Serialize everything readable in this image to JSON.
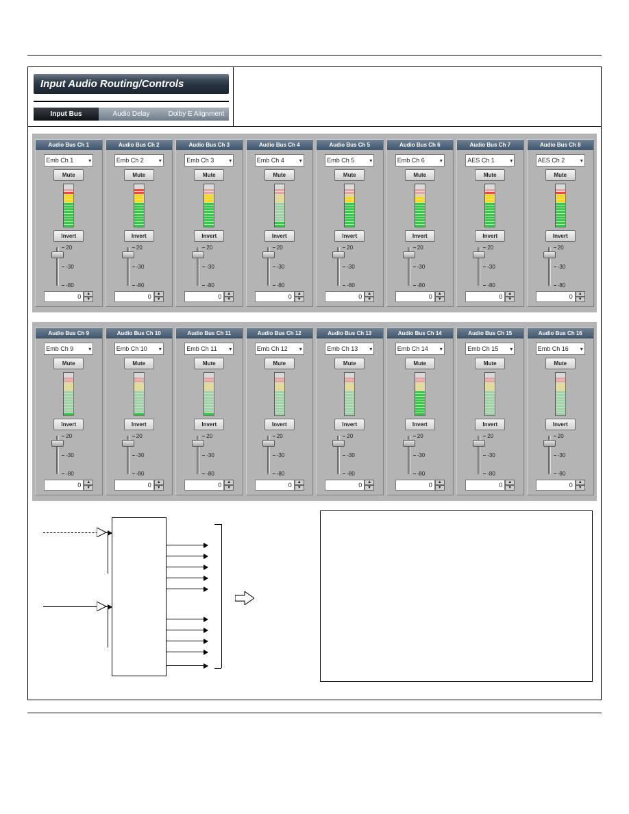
{
  "header": {
    "title": "Input Audio Routing/Controls",
    "tabs": [
      "Input Bus",
      "Audio Delay",
      "Dolby E Alignment"
    ],
    "active_tab": 0
  },
  "ui": {
    "mute_label": "Mute",
    "invert_label": "Invert",
    "slider_ticks": [
      "20",
      "-30",
      "-80"
    ],
    "dropdown_caret": "▾"
  },
  "channels_top": [
    {
      "header": "Audio Bus Ch 1",
      "source": "Emb Ch 1",
      "gain": 0,
      "meter_on": 13
    },
    {
      "header": "Audio Bus Ch 2",
      "source": "Emb Ch 2",
      "gain": 0,
      "meter_on": 14
    },
    {
      "header": "Audio Bus Ch 3",
      "source": "Emb Ch 3",
      "gain": 0,
      "meter_on": 12
    },
    {
      "header": "Audio Bus Ch 4",
      "source": "Emb Ch 4",
      "gain": 0,
      "meter_on": 2
    },
    {
      "header": "Audio Bus Ch 5",
      "source": "Emb Ch 5",
      "gain": 0,
      "meter_on": 11
    },
    {
      "header": "Audio Bus Ch 6",
      "source": "Emb Ch 6",
      "gain": 0,
      "meter_on": 11
    },
    {
      "header": "Audio Bus Ch 7",
      "source": "AES Ch 1",
      "gain": 0,
      "meter_on": 13
    },
    {
      "header": "Audio Bus Ch 8",
      "source": "AES Ch 2",
      "gain": 0,
      "meter_on": 13
    }
  ],
  "channels_bottom": [
    {
      "header": "Audio Bus Ch 9",
      "source": "Emb Ch 9",
      "gain": 0,
      "meter_on": 1
    },
    {
      "header": "Audio Bus Ch 10",
      "source": "Emb Ch 10",
      "gain": 0,
      "meter_on": 1
    },
    {
      "header": "Audio Bus Ch 11",
      "source": "Emb Ch 11",
      "gain": 0,
      "meter_on": 1
    },
    {
      "header": "Audio Bus Ch 12",
      "source": "Emb Ch 12",
      "gain": 0,
      "meter_on": 0
    },
    {
      "header": "Audio Bus Ch 13",
      "source": "Emb Ch 13",
      "gain": 0,
      "meter_on": 0
    },
    {
      "header": "Audio Bus Ch 14",
      "source": "Emb Ch 14",
      "gain": 0,
      "meter_on": 9
    },
    {
      "header": "Audio Bus Ch 15",
      "source": "Emb Ch 15",
      "gain": 0,
      "meter_on": 0
    },
    {
      "header": "Audio Bus Ch 16",
      "source": "Emb Ch 16",
      "gain": 0,
      "meter_on": 0
    }
  ]
}
